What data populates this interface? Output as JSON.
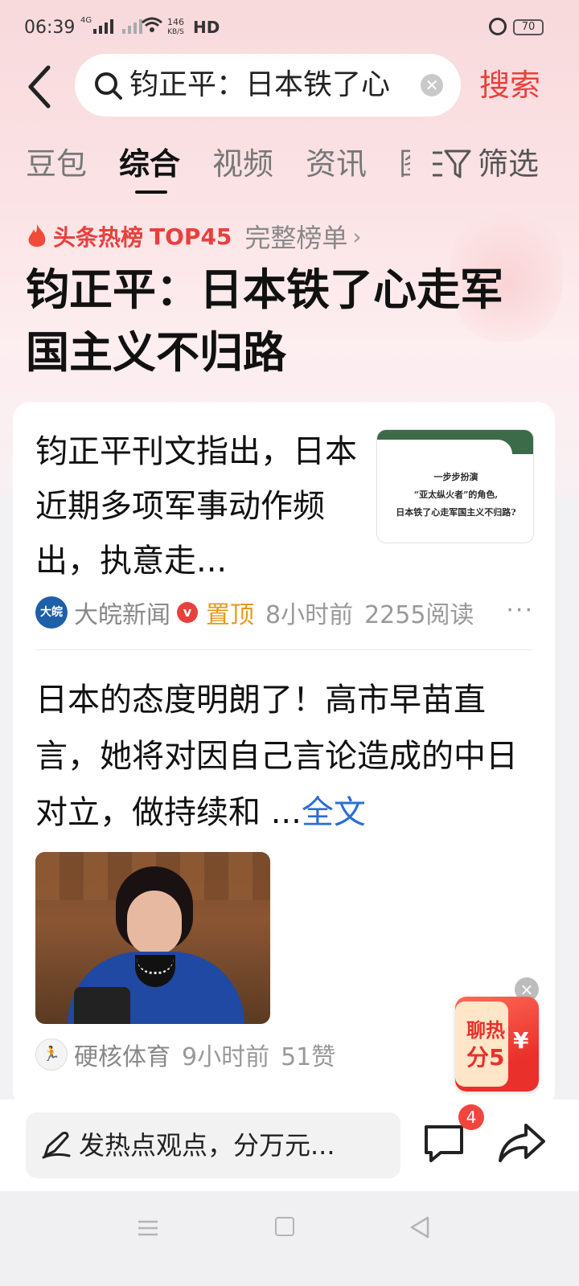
{
  "status_bar": {
    "time": "06:39",
    "network": "4G",
    "speed_value": "146",
    "speed_unit": "KB/S",
    "hd": "HD",
    "battery": "70"
  },
  "search": {
    "query": "钧正平：日本铁了心",
    "button_label": "搜索"
  },
  "tabs": [
    {
      "label": "豆包"
    },
    {
      "label": "综合",
      "active": true
    },
    {
      "label": "视频"
    },
    {
      "label": "资讯"
    },
    {
      "label": "图"
    }
  ],
  "filter_label": "筛选",
  "hot_rank": {
    "label": "头条热榜",
    "rank": "TOP45",
    "full_list": "完整榜单"
  },
  "topic_title": "钧正平：日本铁了心走军国主义不归路",
  "articles": [
    {
      "title": "钧正平刊文指出，日本近期多项军事动作频出，执意走...",
      "thumb_lines": [
        "一步步扮演",
        "“亚太纵火者”的角色,",
        "日本铁了心走军国主义不归路?"
      ],
      "source_logo_text": "大皖",
      "source": "大皖新闻",
      "verified": "v",
      "pinned": "置顶",
      "time": "8小时前",
      "reads": "2255阅读",
      "more": "···"
    },
    {
      "title": "日本的态度明朗了！高市早苗直言，她将对因自己言论造成的中日对立，做持续和 ...",
      "read_full": "全文",
      "source_logo_text": "🏃",
      "source": "硬核体育",
      "time": "9小时前",
      "likes": "51赞"
    }
  ],
  "float_ad": {
    "line1": "聊热",
    "line2": "分5",
    "yen": "¥",
    "close": "×"
  },
  "bottom_bar": {
    "comment_placeholder": "发热点观点，分万元...",
    "comment_count": "4"
  },
  "colors": {
    "accent_red": "#e8403d",
    "link_blue": "#2a6ed8",
    "pin_orange": "#e59a1a"
  }
}
